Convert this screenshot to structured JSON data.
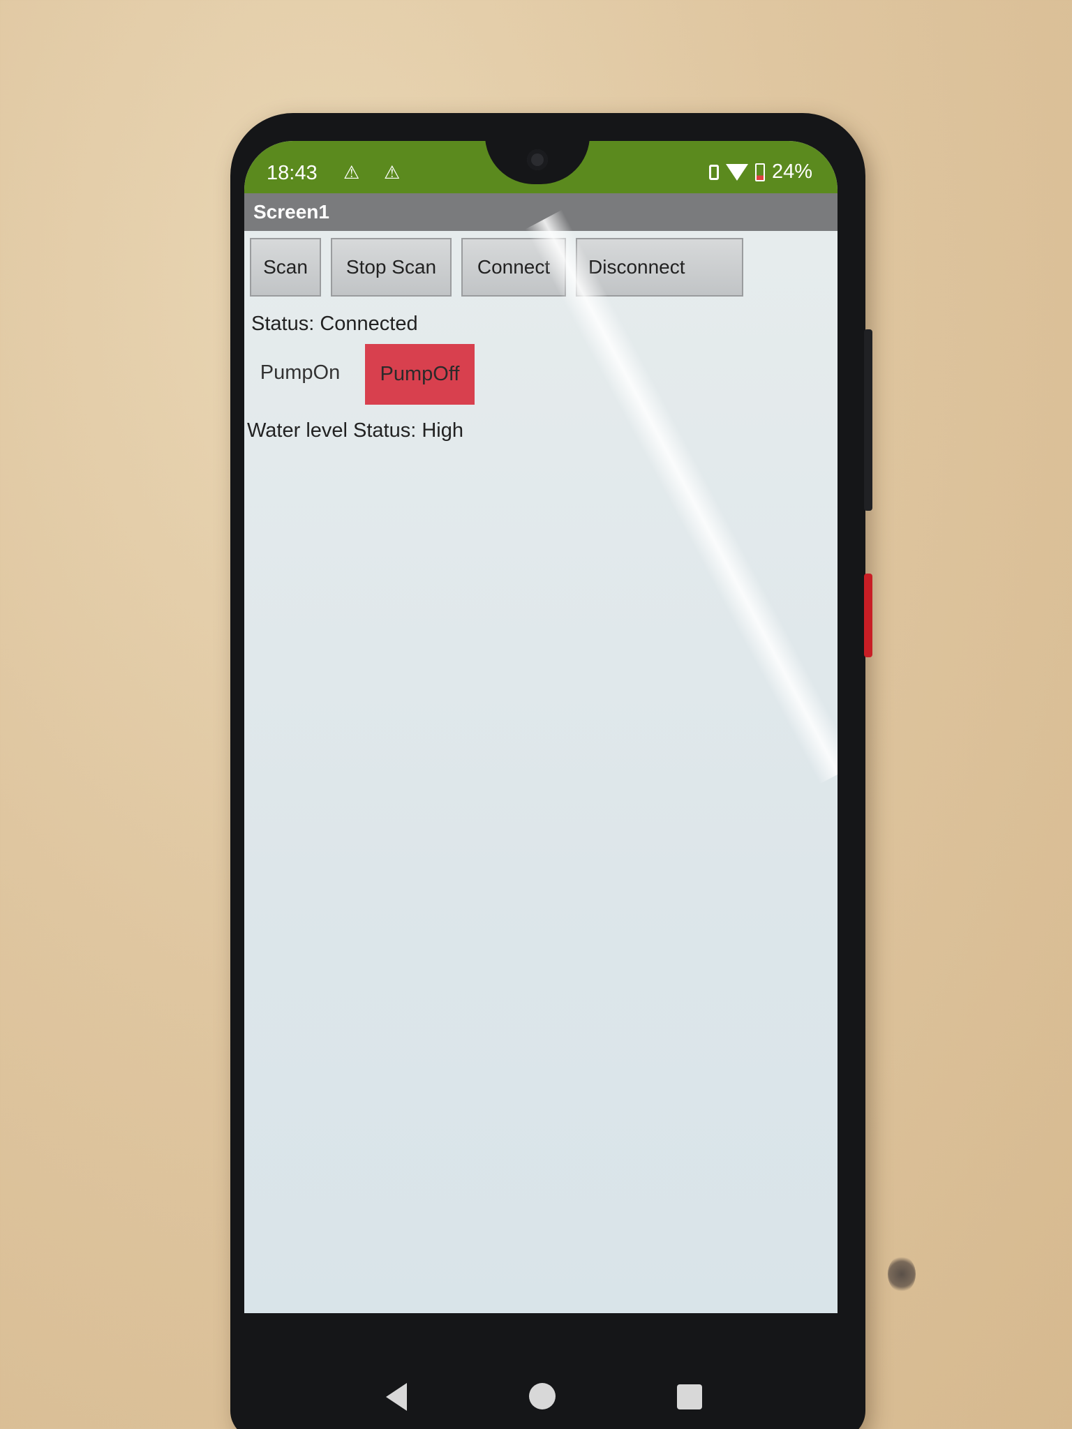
{
  "status_bar": {
    "time": "18:43",
    "warning_icons": [
      "warning-icon",
      "warning-icon"
    ],
    "battery": "24%",
    "icons": [
      "vibrate-icon",
      "wifi-icon",
      "battery-icon"
    ],
    "color": "#5b8a1e"
  },
  "app": {
    "title": "Screen1"
  },
  "buttons": {
    "scan": "Scan",
    "stop_scan": "Stop Scan",
    "connect": "Connect",
    "disconnect": "Disconnect"
  },
  "status": {
    "text": "Status: Connected"
  },
  "pump": {
    "on_label": "PumpOn",
    "off_label": "PumpOff",
    "off_color": "#d8404e"
  },
  "water": {
    "text": "Water level Status:  High"
  },
  "nav": {
    "icons": [
      "back-icon",
      "home-icon",
      "recents-icon"
    ]
  }
}
